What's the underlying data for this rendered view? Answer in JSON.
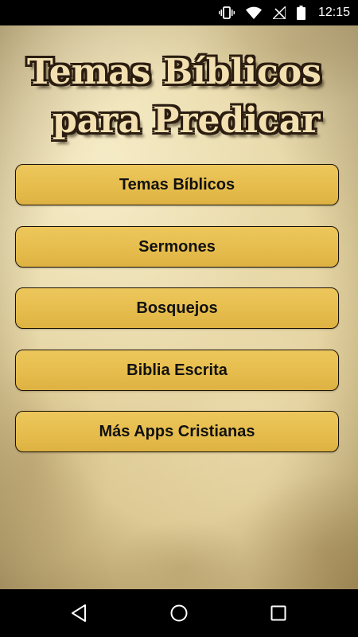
{
  "status_bar": {
    "time": "12:15",
    "icons": [
      "vibrate-icon",
      "wifi-icon",
      "no-signal-icon",
      "battery-icon"
    ]
  },
  "app": {
    "title_line1": "Temas Bíblicos",
    "title_line2": "para Predicar"
  },
  "menu": {
    "items": [
      {
        "label": "Temas Bíblicos"
      },
      {
        "label": "Sermones"
      },
      {
        "label": "Bosquejos"
      },
      {
        "label": "Biblia Escrita"
      },
      {
        "label": "Más Apps Cristianas"
      }
    ]
  },
  "nav_bar": {
    "icons": [
      "back-icon",
      "home-icon",
      "recents-icon"
    ]
  },
  "colors": {
    "button_fill": "#e6bd4d",
    "button_border": "#1a1208",
    "parchment": "#e7d6a4",
    "title_fill": "#f2e0b1",
    "title_outline": "#2b1d10"
  }
}
